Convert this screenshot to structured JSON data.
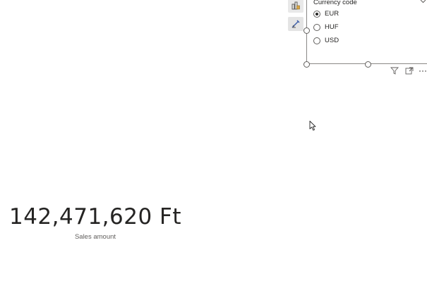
{
  "slicer": {
    "title": "Currency code",
    "options": [
      {
        "label": "EUR",
        "selected": true
      },
      {
        "label": "HUF",
        "selected": false
      },
      {
        "label": "USD",
        "selected": false
      }
    ]
  },
  "card": {
    "value": "142,471,620 Ft",
    "label": "Sales amount"
  },
  "icons": {
    "tool_1": "build-visual-icon",
    "tool_2": "format-visual-icon",
    "header": [
      "filter-icon",
      "focus-mode-icon",
      "more-options-icon"
    ]
  },
  "colors": {
    "text": "#252423",
    "secondary_text": "#605e5c",
    "border": "#8a8886",
    "tool_button_bg": "#e9e9e9"
  }
}
